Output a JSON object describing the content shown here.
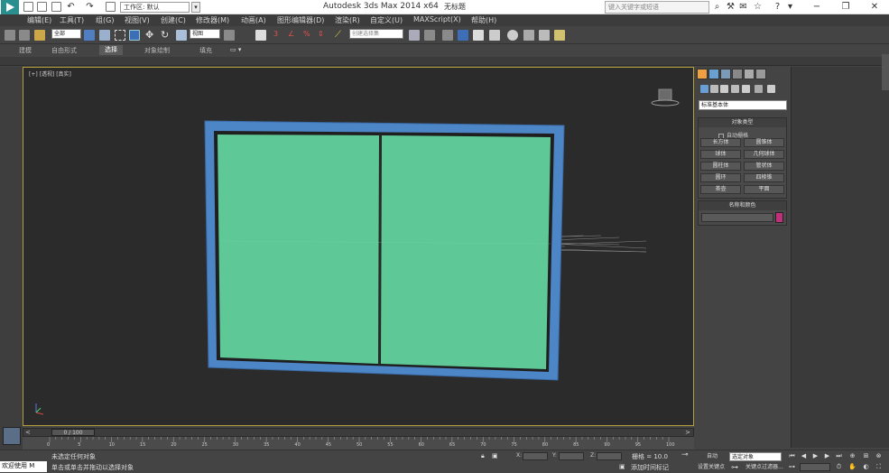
{
  "titlebar": {
    "workspace_label": "工作区: 默认",
    "app_title": "Autodesk 3ds Max  2014 x64",
    "file_name": "无标题",
    "search_placeholder": "键入关键字或短语"
  },
  "menubar": {
    "items": [
      "编辑(E)",
      "工具(T)",
      "组(G)",
      "视图(V)",
      "创建(C)",
      "修改器(M)",
      "动画(A)",
      "图形编辑器(D)",
      "渲染(R)",
      "自定义(U)",
      "MAXScript(X)",
      "帮助(H)"
    ]
  },
  "toolbar": {
    "selection_filter": "全部",
    "ref_coord": "视图",
    "named_selection": "创建选择集"
  },
  "ribbon": {
    "tabs": [
      "建模",
      "自由形式",
      "选择",
      "对象绘制",
      "填充"
    ],
    "active_tab": "选择"
  },
  "viewport": {
    "label": "[+] [透视] [真实]",
    "colors": {
      "frame": "#4d86c6",
      "glass": "#5ec996",
      "background": "#2b2b2b",
      "active_border": "#b4a03a"
    }
  },
  "command_panel": {
    "category_dropdown": "标准基本体",
    "object_type_header": "对象类型",
    "auto_grid_label": "自动栅格",
    "object_buttons": [
      "长方体",
      "圆锥体",
      "球体",
      "几何球体",
      "圆柱体",
      "管状体",
      "圆环",
      "四棱锥",
      "茶壶",
      "平面"
    ],
    "name_color_header": "名称和颜色",
    "swatch_color": "#c0307a"
  },
  "timeline": {
    "frame_display": "0 / 100",
    "ticks": [
      "0",
      "5",
      "10",
      "15",
      "20",
      "25",
      "30",
      "35",
      "40",
      "45",
      "50",
      "55",
      "60",
      "65",
      "70",
      "75",
      "80",
      "85",
      "90",
      "95",
      "100"
    ]
  },
  "statusbar": {
    "maxscript_label": "欢迎使用 M",
    "status_line1": "未选定任何对象",
    "status_line2": "单击或单击并拖动以选择对象",
    "x_label": "X:",
    "y_label": "Y:",
    "z_label": "Z:",
    "grid_text": "栅格 = 10.0",
    "add_time_tag": "添加时间标记",
    "auto_key_label": "自动",
    "set_key_label": "设置关键点",
    "key_filter_select": "选定对象",
    "key_filters_label": "关键点过滤器..."
  }
}
